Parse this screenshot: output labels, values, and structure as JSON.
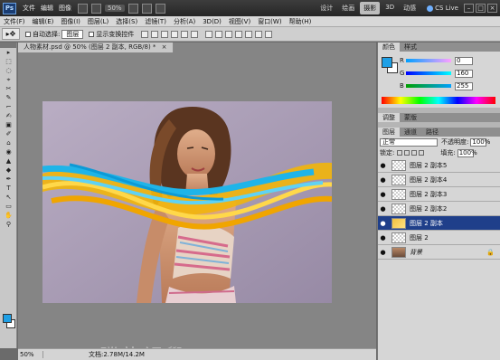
{
  "app": {
    "logo": "Ps",
    "menu": [
      "文件",
      "编辑",
      "图像"
    ],
    "zoom": "50%",
    "workspaces": [
      "设计",
      "绘画",
      "摄影",
      "3D",
      "动感"
    ],
    "active_workspace": "摄影",
    "cs_live": "CS Live",
    "win_buttons": [
      "–",
      "□",
      "×"
    ]
  },
  "menubar": [
    "文件(F)",
    "编辑(E)",
    "图像(I)",
    "图层(L)",
    "选择(S)",
    "滤镜(T)",
    "分析(A)",
    "3D(D)",
    "视图(V)",
    "窗口(W)",
    "帮助(H)"
  ],
  "options": {
    "tool_glyph": "▸✥",
    "auto_select_label": "自动选择:",
    "auto_select_value": "图层",
    "transform_controls_label": "显示变换控件"
  },
  "document": {
    "tab_title": "人物素材.psd @ 50% (图层 2 副本, RGB/8) *",
    "close": "×",
    "status_zoom": "50%",
    "status_doc": "文档:2.78M/14.2M"
  },
  "watermark": "腾龍視覺 WWW.TLVI.NET",
  "color_panel": {
    "tabs": [
      "颜色",
      "样式"
    ],
    "r_label": "R",
    "r_value": "0",
    "g_label": "G",
    "g_value": "160",
    "b_label": "B",
    "b_value": "255",
    "fg_color": "#1fa0e6"
  },
  "adjust_tabs": [
    "调整",
    "蒙版"
  ],
  "layers_panel": {
    "tabs": [
      "图层",
      "通道",
      "路径"
    ],
    "blend_mode": "正常",
    "opacity_label": "不透明度:",
    "opacity_value": "100%",
    "lock_label": "锁定:",
    "fill_label": "填充:",
    "fill_value": "100%",
    "layers": [
      {
        "name": "图层 2 副本5",
        "selected": false
      },
      {
        "name": "图层 2 副本4",
        "selected": false
      },
      {
        "name": "图层 2 副本3",
        "selected": false
      },
      {
        "name": "图层 2 副本2",
        "selected": false
      },
      {
        "name": "图层 2 副本",
        "selected": true
      },
      {
        "name": "图层 2",
        "selected": false
      }
    ],
    "background_layer": "背景"
  },
  "tools": [
    "▸",
    "⬚",
    "◌",
    "⌖",
    "✂",
    "✎",
    "⌐",
    "✍",
    "▣",
    "✐",
    "⌂",
    "◉",
    "▲",
    "◆",
    "✒",
    "T",
    "↖",
    "▭",
    "✋",
    "⚲"
  ]
}
